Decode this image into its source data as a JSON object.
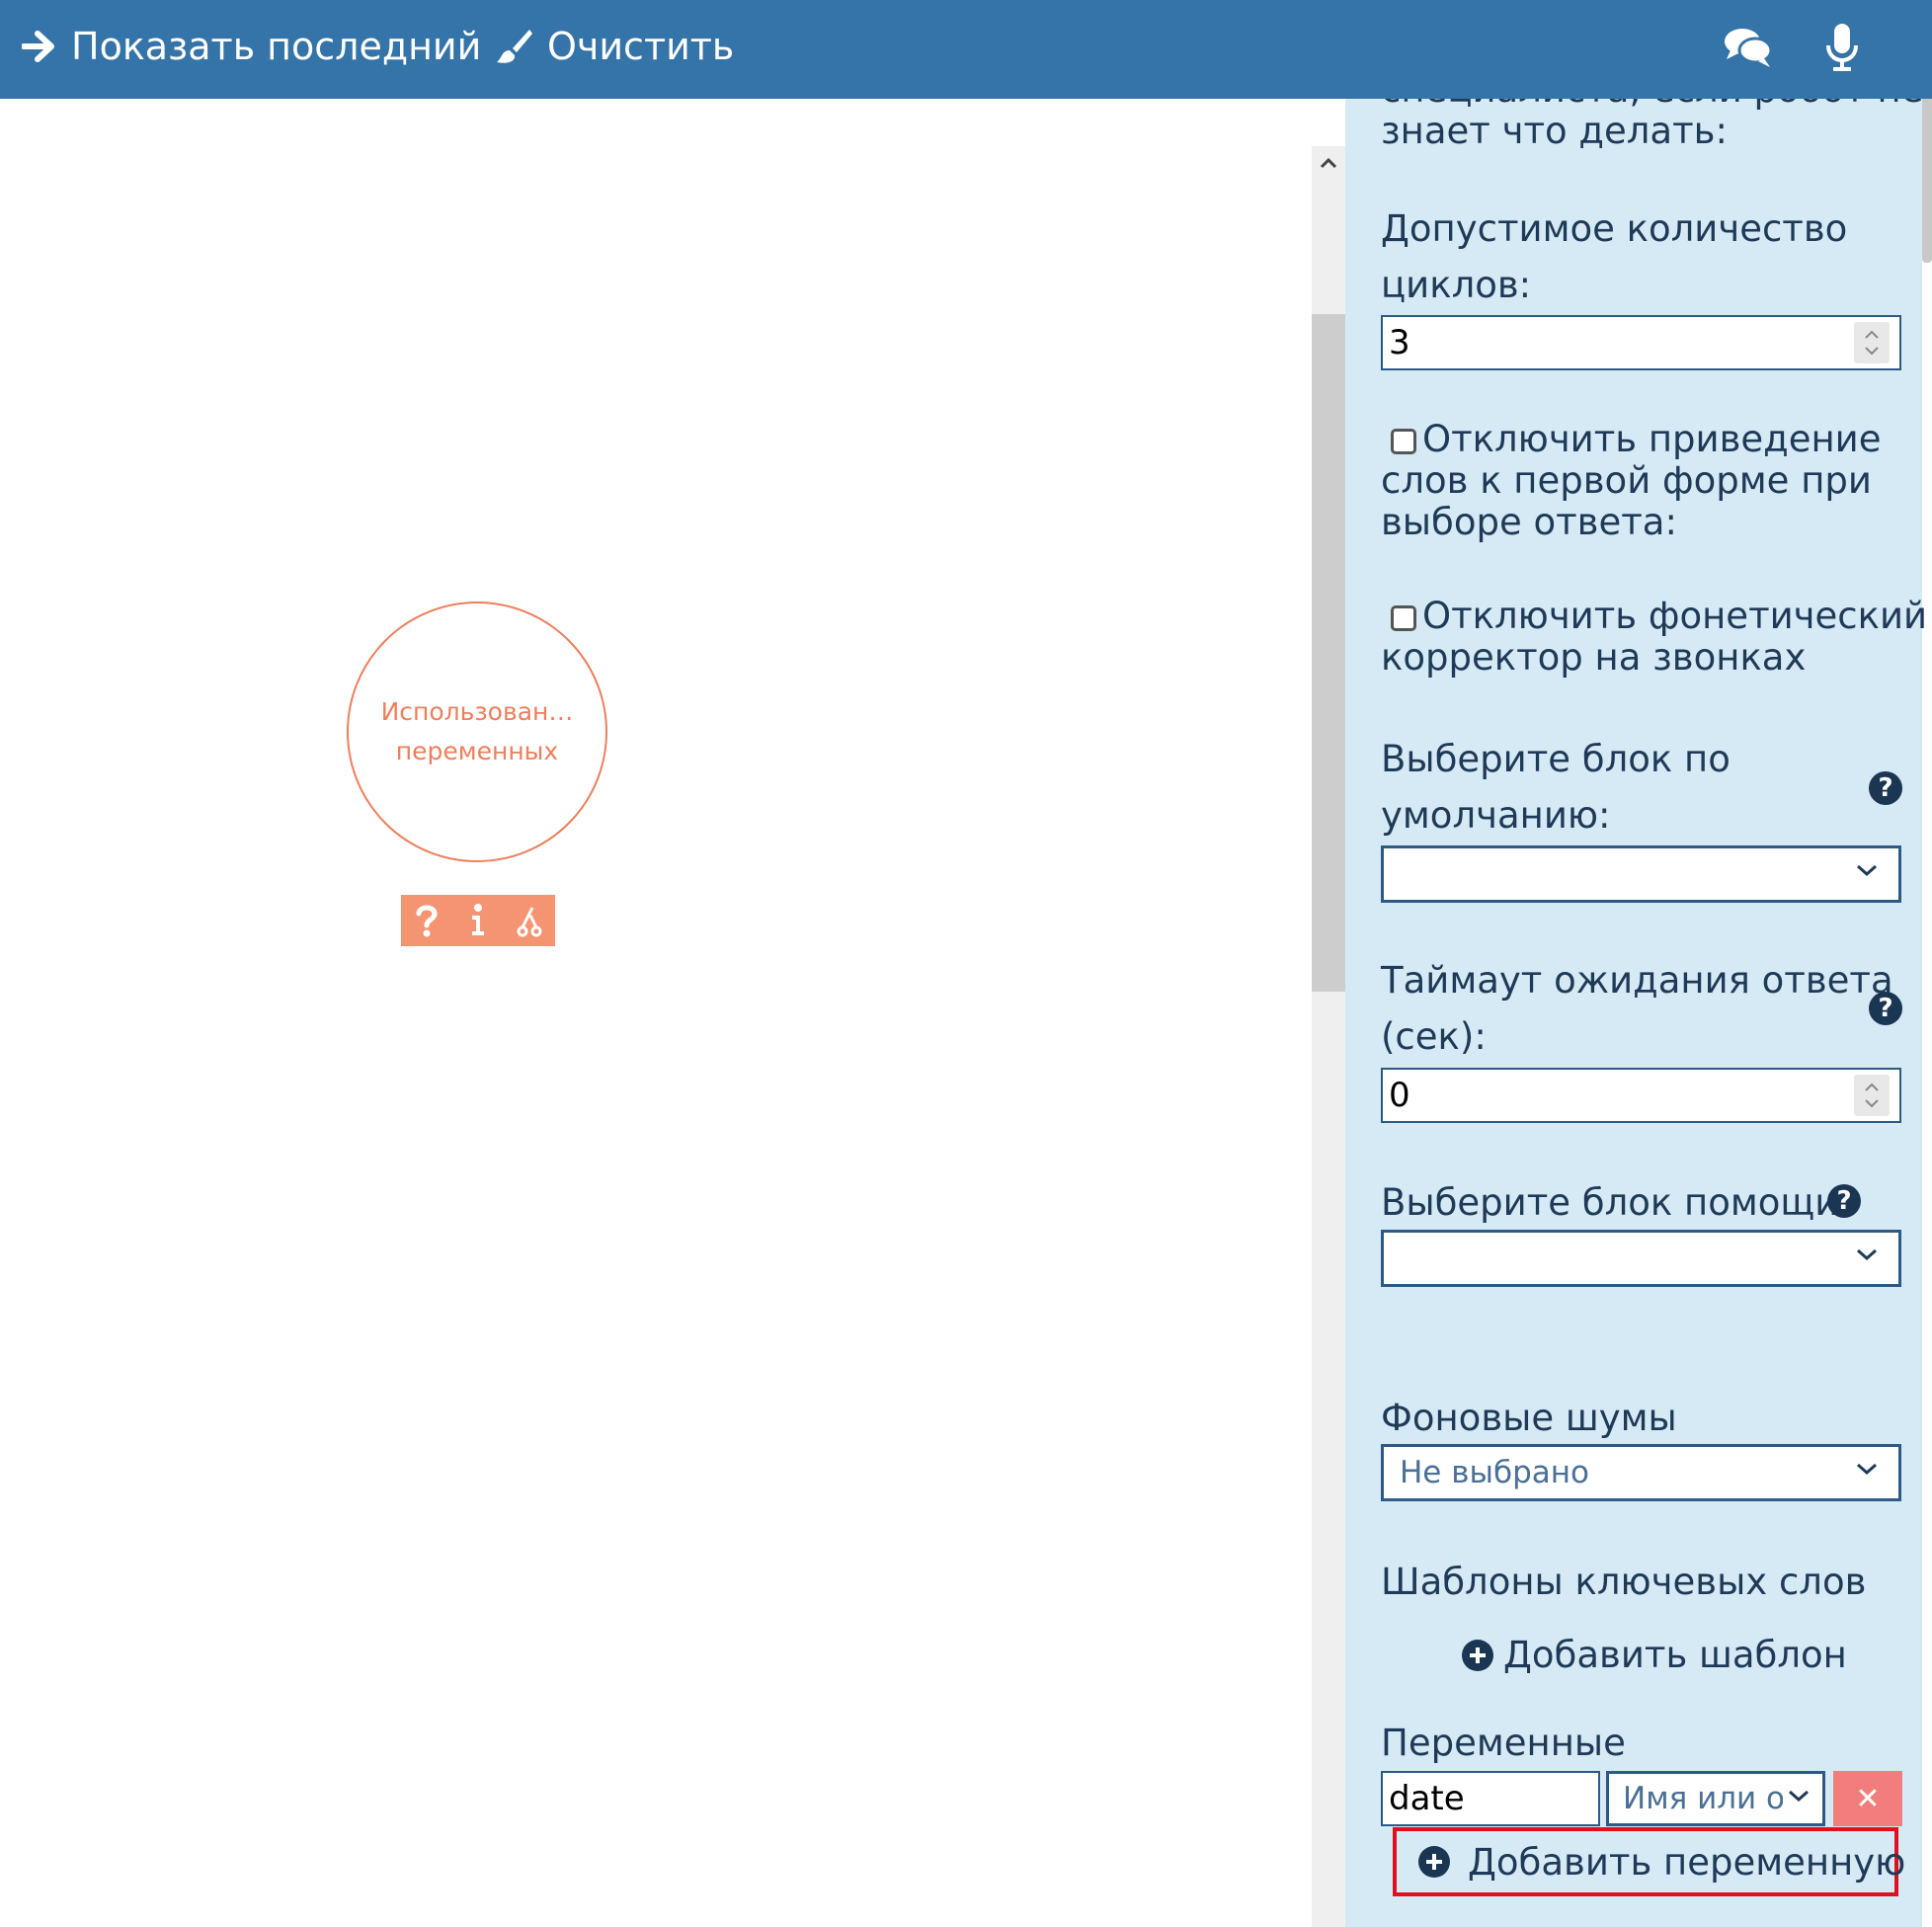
{
  "toolbar": {
    "show_last_label": "Показать последний",
    "clear_label": "Очистить"
  },
  "canvas": {
    "node_line1": "Использован…",
    "node_line2": "переменных",
    "tools": [
      "question-icon",
      "info-icon",
      "branch-icon"
    ]
  },
  "panel": {
    "cut_label_line1": "специалиста, если робот не",
    "cut_label_line2": "знает что делать:",
    "cycles_label_line1": "Допустимое количество",
    "cycles_label_line2": "циклов:",
    "cycles_value": "3",
    "disable_lemma_line1": "Отключить приведение",
    "disable_lemma_line2": "слов к первой форме при",
    "disable_lemma_line3": "выборе ответа:",
    "disable_phonetic_line1": "Отключить фонетический",
    "disable_phonetic_line2": "корректор на звонках",
    "default_block_line1": "Выберите блок по",
    "default_block_line2": "умолчанию:",
    "default_block_value": "",
    "timeout_line1": "Таймаут ожидания ответа",
    "timeout_line2": "(сек):",
    "timeout_value": "0",
    "help_block_label": "Выберите блок помощи:",
    "help_block_value": "",
    "bg_noise_label": "Фоновые шумы",
    "bg_noise_value": "Не выбрано",
    "keyword_templates_label": "Шаблоны ключевых слов",
    "add_template_label": "Добавить шаблон",
    "variables_label": "Переменные",
    "variable_name_value": "date",
    "variable_type_placeholder": "Имя или о",
    "add_variable_label": "Добавить переменную"
  },
  "colors": {
    "topbar": "#3574a8",
    "panel_bg": "#d6eaf6",
    "node_accent": "#ee7f5c",
    "delete_button": "#f27d7d",
    "highlight_border": "#e0101e"
  }
}
